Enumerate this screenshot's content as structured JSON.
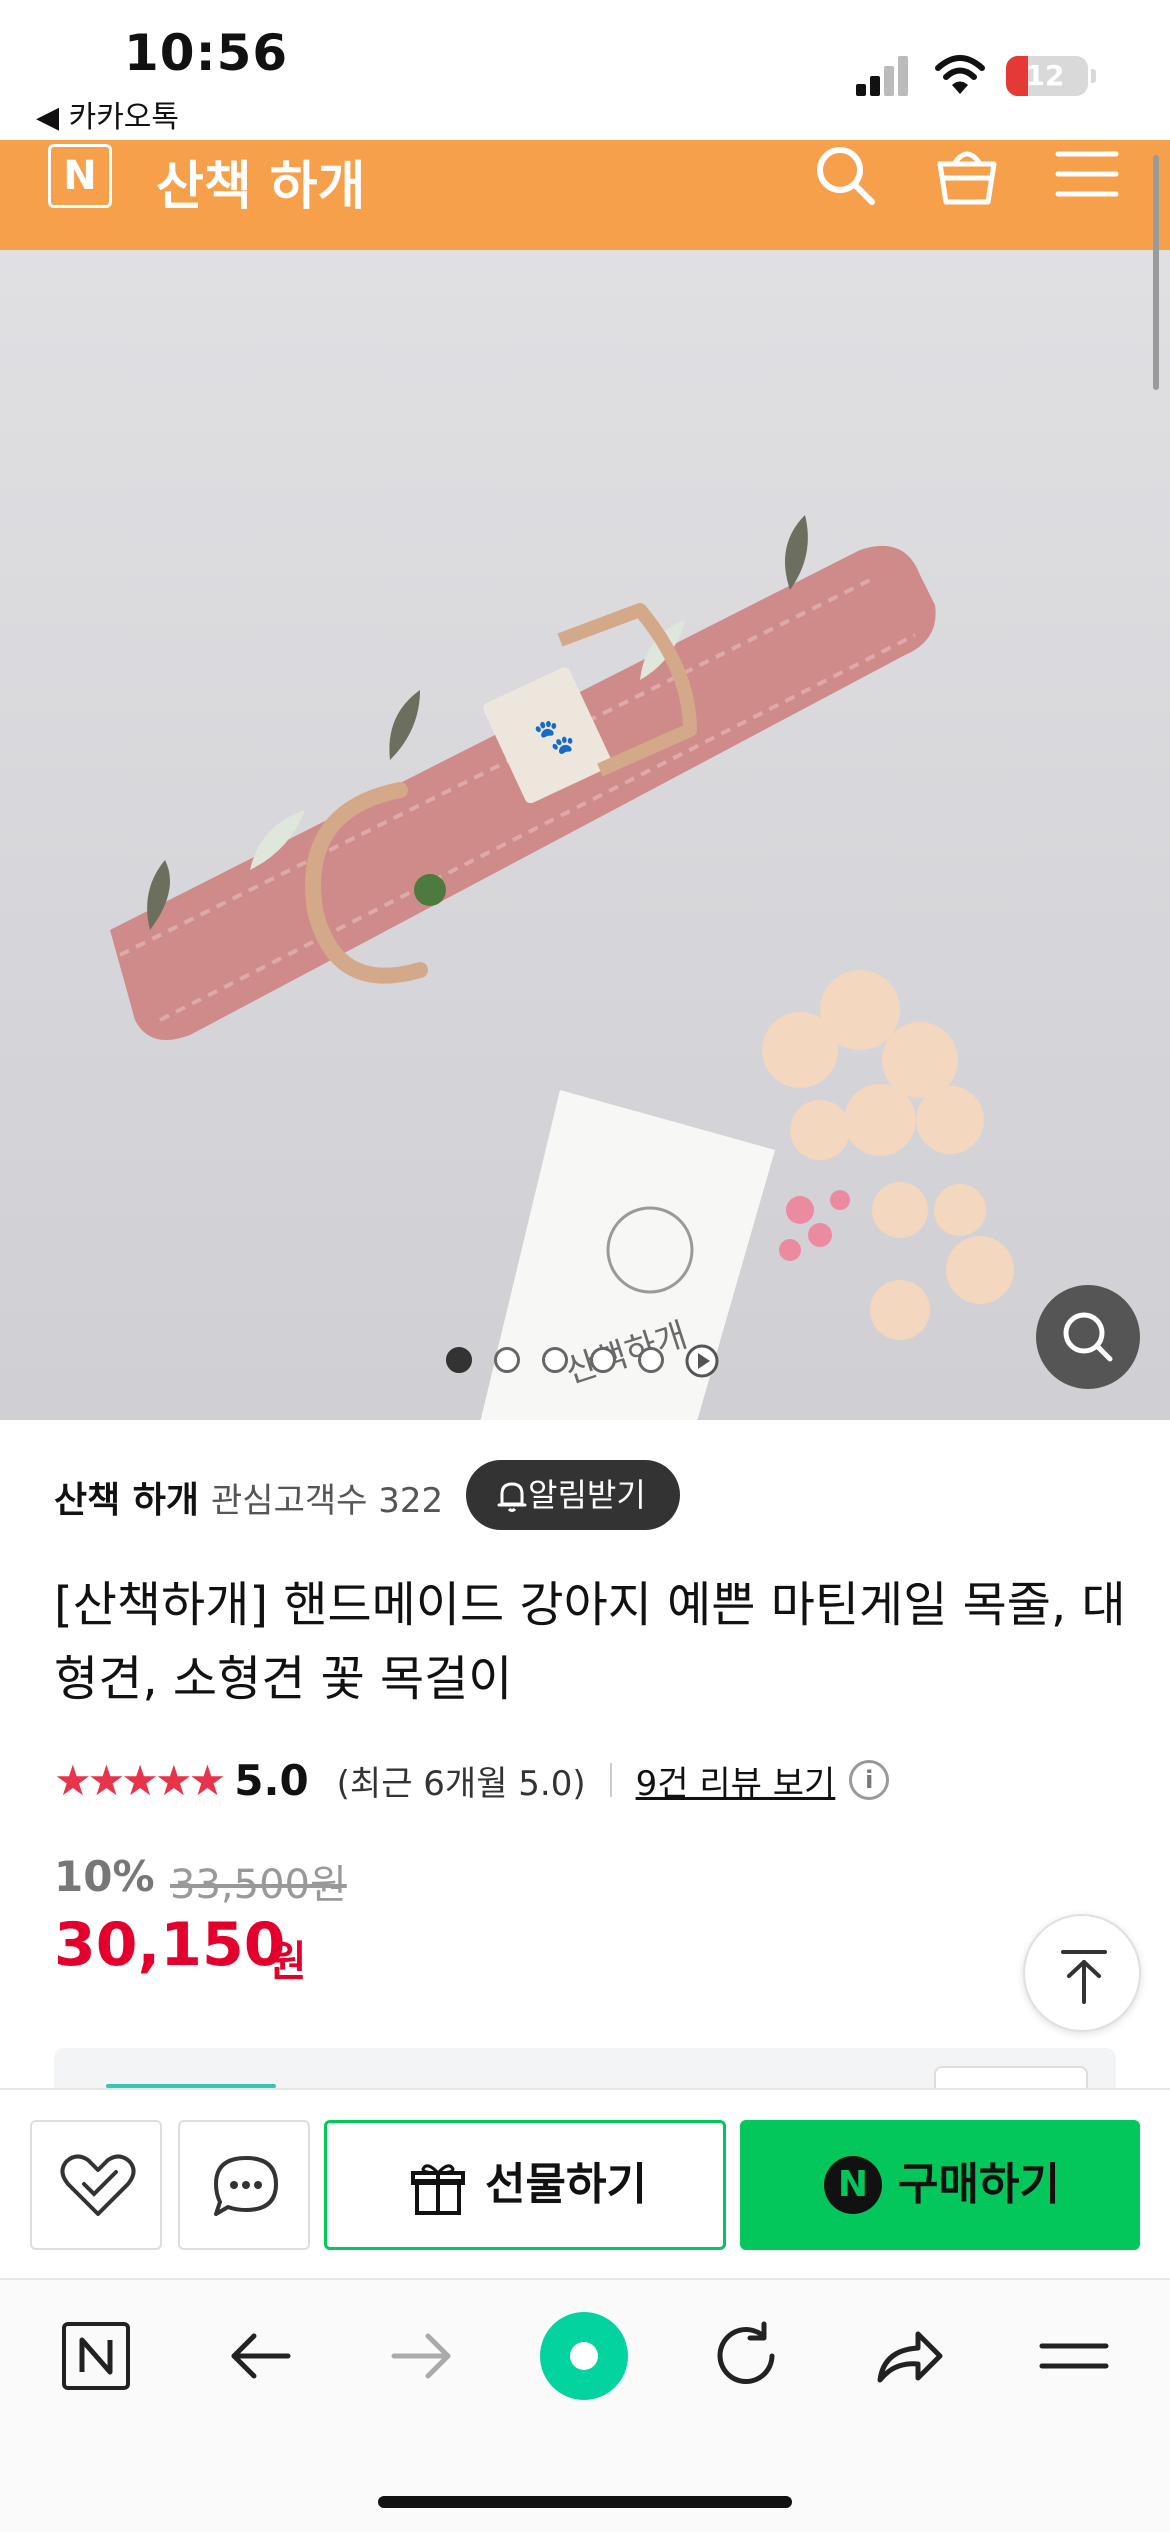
{
  "status_bar": {
    "time": "10:56",
    "back_app": "◀ 카카오톡",
    "battery": "12"
  },
  "header": {
    "logo": "N",
    "store_name": "산책 하개"
  },
  "gallery": {
    "slide_count": 5,
    "active_index": 0,
    "card_text": "산책하개"
  },
  "store": {
    "name": "산책 하개",
    "followers_text": "관심고객수 322",
    "alarm_label": "알림받기"
  },
  "product": {
    "title": "[산책하개] 핸드메이드 강아지 예쁜 마틴게일 목줄, 대형견, 소형견 꽃 목걸이",
    "stars": "★★★★★",
    "score": "5.0",
    "recent_score": "(최근 6개월 5.0)",
    "reviews_link": "9건 리뷰 보기",
    "info_icon": "i",
    "discount": "10%",
    "original_price": "33,500원",
    "price": "30,150",
    "currency": "원"
  },
  "actions": {
    "gift_label": "선물하기",
    "buy_label": "구매하기",
    "buy_logo": "N"
  },
  "colors": {
    "accent": "#f7a04b",
    "naver_green": "#03c75a",
    "price_red": "#e3002c"
  }
}
